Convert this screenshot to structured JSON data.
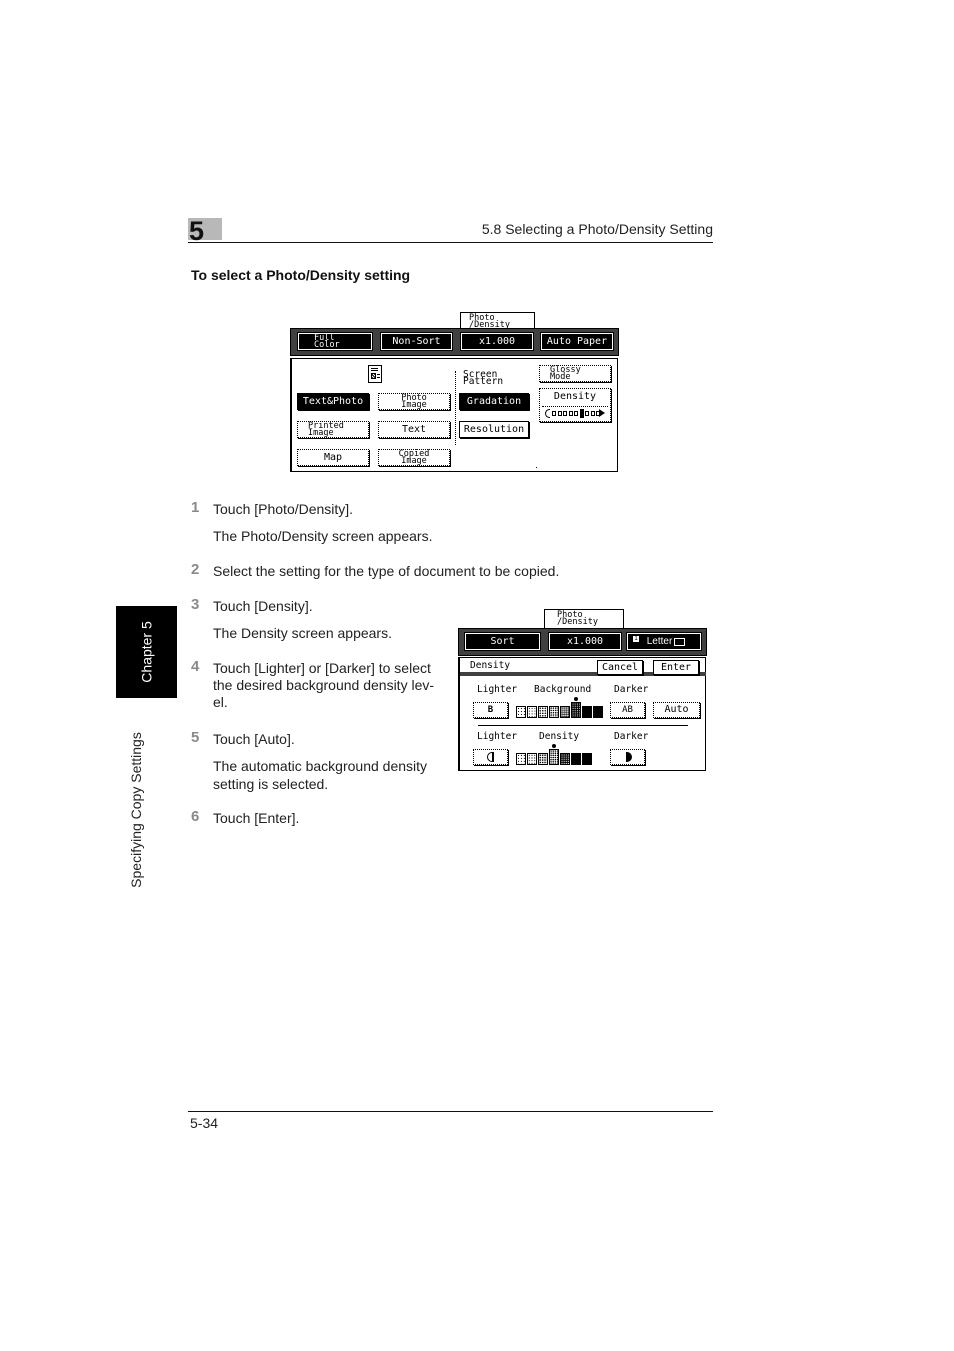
{
  "header": {
    "chapter_number": "5",
    "section_title": "5.8 Selecting a Photo/Density Setting"
  },
  "section_heading": "To select a Photo/Density setting",
  "side_tab": {
    "chapter_label": "Chapter 5",
    "section_label": "Specifying Copy Settings"
  },
  "screen1": {
    "tab_label_line1": "Photo",
    "tab_label_line2": "/Density",
    "topbar": [
      {
        "line1": "Full",
        "line2": "Color"
      },
      {
        "line1": "Non-Sort",
        "line2": ""
      },
      {
        "line1": "x1.000",
        "line2": ""
      },
      {
        "line1": "Auto Paper",
        "line2": ""
      }
    ],
    "doc_icon": "original-document-icon",
    "original_types": [
      {
        "line1": "Text&Photo",
        "line2": "",
        "selected": true
      },
      {
        "line1": "Photo",
        "line2": "Image",
        "selected": false
      },
      {
        "line1": "Printed",
        "line2": "Image",
        "selected": false
      },
      {
        "line1": "Text",
        "line2": "",
        "selected": false
      },
      {
        "line1": "Map",
        "line2": "",
        "selected": false
      },
      {
        "line1": "Copied",
        "line2": "Image",
        "selected": false
      }
    ],
    "screen_pattern_label_line1": "Screen",
    "screen_pattern_label_line2": "Pattern",
    "screen_patterns": [
      {
        "label": "Gradation",
        "selected": true
      },
      {
        "label": "Resolution",
        "selected": false
      }
    ],
    "glossy_line1": "Glossy",
    "glossy_line2": "Mode",
    "density_label": "Density",
    "density_level": 6,
    "density_steps": 9
  },
  "steps": [
    {
      "num": "1",
      "text": "Touch [Photo/Density].",
      "note": "The Photo/Density screen appears."
    },
    {
      "num": "2",
      "text": "Select the setting for the type of document to be copied.",
      "note": ""
    },
    {
      "num": "3",
      "text": "Touch [Density].",
      "note": "The Density screen appears."
    },
    {
      "num": "4",
      "text_lines": [
        "Touch [Lighter] or [Darker] to select",
        "the desired background density lev-",
        "el."
      ]
    },
    {
      "num": "5",
      "text": "Touch [Auto].",
      "note_lines": [
        "The automatic background density",
        "setting is selected."
      ]
    },
    {
      "num": "6",
      "text": "Touch [Enter]."
    }
  ],
  "screen2": {
    "tab_label_line1": "Photo",
    "tab_label_line2": "/Density",
    "topbar": [
      {
        "label": "Sort"
      },
      {
        "label": "x1.000"
      },
      {
        "label": "Letter",
        "prefix_icon": "tray-1-icon",
        "suffix_icon": "paper-landscape-icon"
      }
    ],
    "title": "Density",
    "cancel_label": "Cancel",
    "enter_label": "Enter",
    "background": {
      "lighter_label": "Lighter",
      "center_label": "Background",
      "darker_label": "Darker",
      "lighter_button": "B",
      "darker_button": "AB",
      "auto_label": "Auto",
      "level": 6,
      "steps": 8
    },
    "density": {
      "lighter_label": "Lighter",
      "center_label": "Density",
      "darker_label": "Darker",
      "level": 4,
      "steps": 7
    }
  },
  "footer": {
    "page_number": "5-34"
  }
}
